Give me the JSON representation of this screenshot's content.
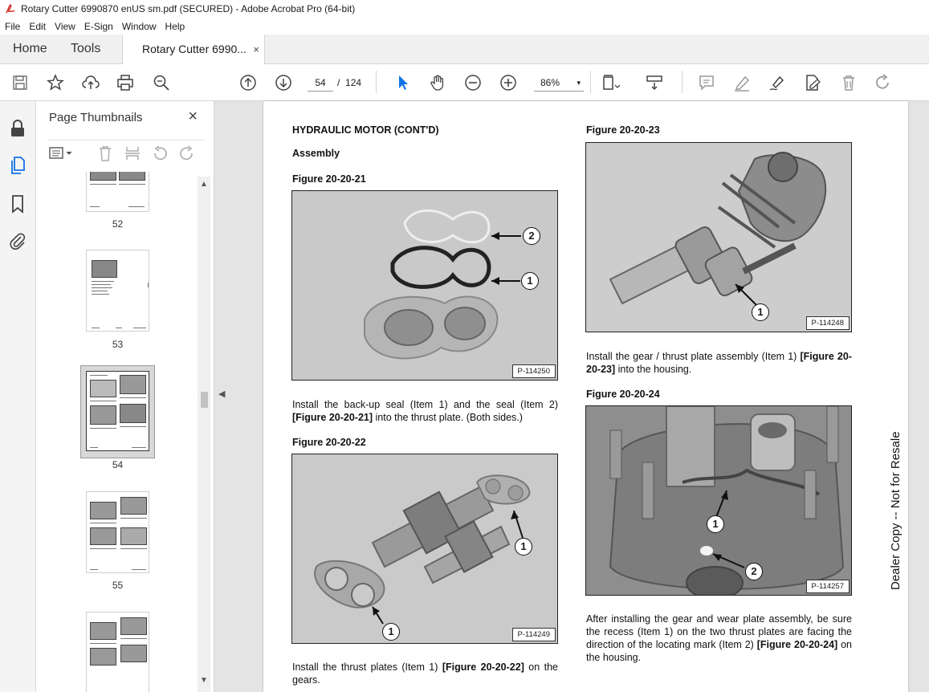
{
  "window": {
    "title": "Rotary Cutter 6990870 enUS sm.pdf (SECURED) - Adobe Acrobat Pro (64-bit)"
  },
  "menu": [
    "File",
    "Edit",
    "View",
    "E-Sign",
    "Window",
    "Help"
  ],
  "tabs": {
    "home": "Home",
    "tools": "Tools",
    "document": "Rotary Cutter 6990...",
    "close": "×"
  },
  "toolbar": {
    "current_page": "54",
    "page_separator": "/",
    "total_pages": "124",
    "zoom": "86%",
    "zoom_caret": "▾"
  },
  "sidebar": {
    "title": "Page Thumbnails",
    "close": "×",
    "thumbnails": [
      {
        "label": "52"
      },
      {
        "label": "53"
      },
      {
        "label": "54",
        "selected": true
      },
      {
        "label": "55"
      }
    ]
  },
  "page": {
    "heading": "HYDRAULIC MOTOR (CONT'D)",
    "subheading": "Assembly",
    "fig21": {
      "title": "Figure 20-20-21",
      "code": "P-114250",
      "callouts": [
        "2",
        "1"
      ]
    },
    "para21": {
      "text": "Install the back-up seal (Item 1) and the seal (Item 2) ",
      "ref": "[Figure 20-20-21]",
      "tail": " into the thrust plate. (Both sides.)"
    },
    "fig22": {
      "title": "Figure 20-20-22",
      "code": "P-114249",
      "callouts": [
        "1",
        "1"
      ]
    },
    "para22": {
      "text": "Install the thrust plates (Item 1) ",
      "ref": "[Figure 20-20-22]",
      "tail": " on the gears."
    },
    "fig23": {
      "title": "Figure 20-20-23",
      "code": "P-114248",
      "callouts": [
        "1"
      ]
    },
    "para23": {
      "text": "Install the gear / thrust plate assembly (Item 1) ",
      "ref": "[Figure 20-20-23]",
      "tail": " into the housing."
    },
    "fig24": {
      "title": "Figure 20-20-24",
      "code": "P-114257",
      "callouts": [
        "1",
        "2"
      ]
    },
    "para24": {
      "text": "After installing the gear and wear plate assembly, be sure the recess (Item 1) on the two thrust plates are facing the direction of the locating mark (Item 2) ",
      "ref": "[Figure 20-20-24]",
      "tail": " on the housing."
    },
    "side_text": "Dealer Copy -- Not for Resale"
  }
}
